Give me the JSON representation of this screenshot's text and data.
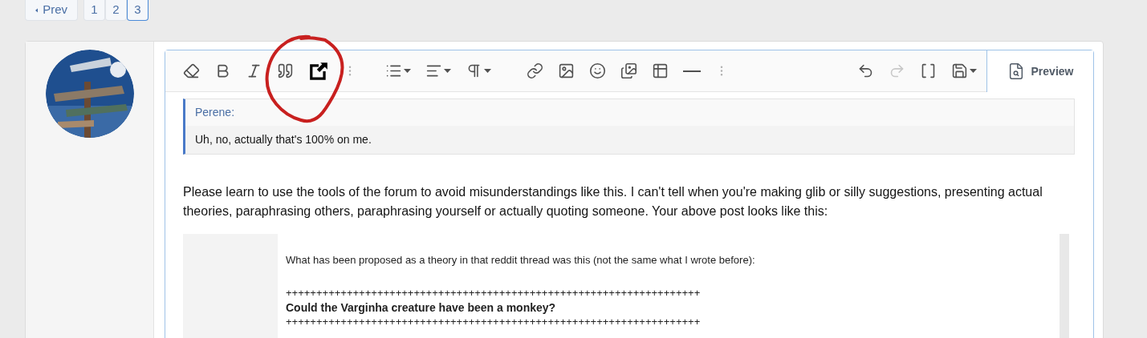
{
  "pagination": {
    "prev": "Prev",
    "pages": [
      {
        "label": "1",
        "selected": false
      },
      {
        "label": "2",
        "selected": false
      },
      {
        "label": "3",
        "selected": true
      }
    ]
  },
  "editor": {
    "toolbar_left": [
      {
        "menu": false,
        "disabled": false
      },
      {
        "menu": false,
        "disabled": false
      },
      {
        "menu": false,
        "disabled": false
      },
      {
        "menu": false,
        "disabled": false
      },
      {
        "menu": false,
        "disabled": false
      },
      {
        "menu": false,
        "disabled": false
      },
      {
        "menu": true,
        "disabled": false
      },
      {
        "menu": true,
        "disabled": false
      },
      {
        "menu": true,
        "disabled": false
      },
      {
        "menu": false,
        "disabled": false
      },
      {
        "menu": false,
        "disabled": false
      },
      {
        "menu": false,
        "disabled": false
      },
      {
        "menu": false,
        "disabled": false
      },
      {
        "menu": false,
        "disabled": false
      },
      {
        "menu": false,
        "disabled": false
      },
      {
        "menu": false,
        "disabled": false
      }
    ],
    "toolbar_right": [
      {
        "menu": false,
        "disabled": false
      },
      {
        "menu": false,
        "disabled": true
      },
      {
        "menu": false,
        "disabled": false
      },
      {
        "menu": true,
        "disabled": false
      }
    ],
    "preview": "Preview",
    "quote": {
      "author": "Perene:",
      "text": "Uh, no, actually that's 100% on me."
    },
    "body": "Please learn to use the tools of the forum to avoid misunderstandings like this. I can't tell when you're making glib or silly suggestions, presenting actual theories, paraphrasing others, paraphrasing yourself or actually quoting someone. Your above post looks like this:",
    "embedded_screenshot": {
      "text": "What has been proposed as a theory in that reddit thread was this (not the same what I wrote before):",
      "divider_top": "++++++++++++++++++++++++++++++++++++++++++++++++++++++++++++++++++++",
      "title": "Could the Varginha creature have been a monkey?",
      "divider_bottom": "++++++++++++++++++++++++++++++++++++++++++++++++++++++++++++++++++++"
    }
  }
}
